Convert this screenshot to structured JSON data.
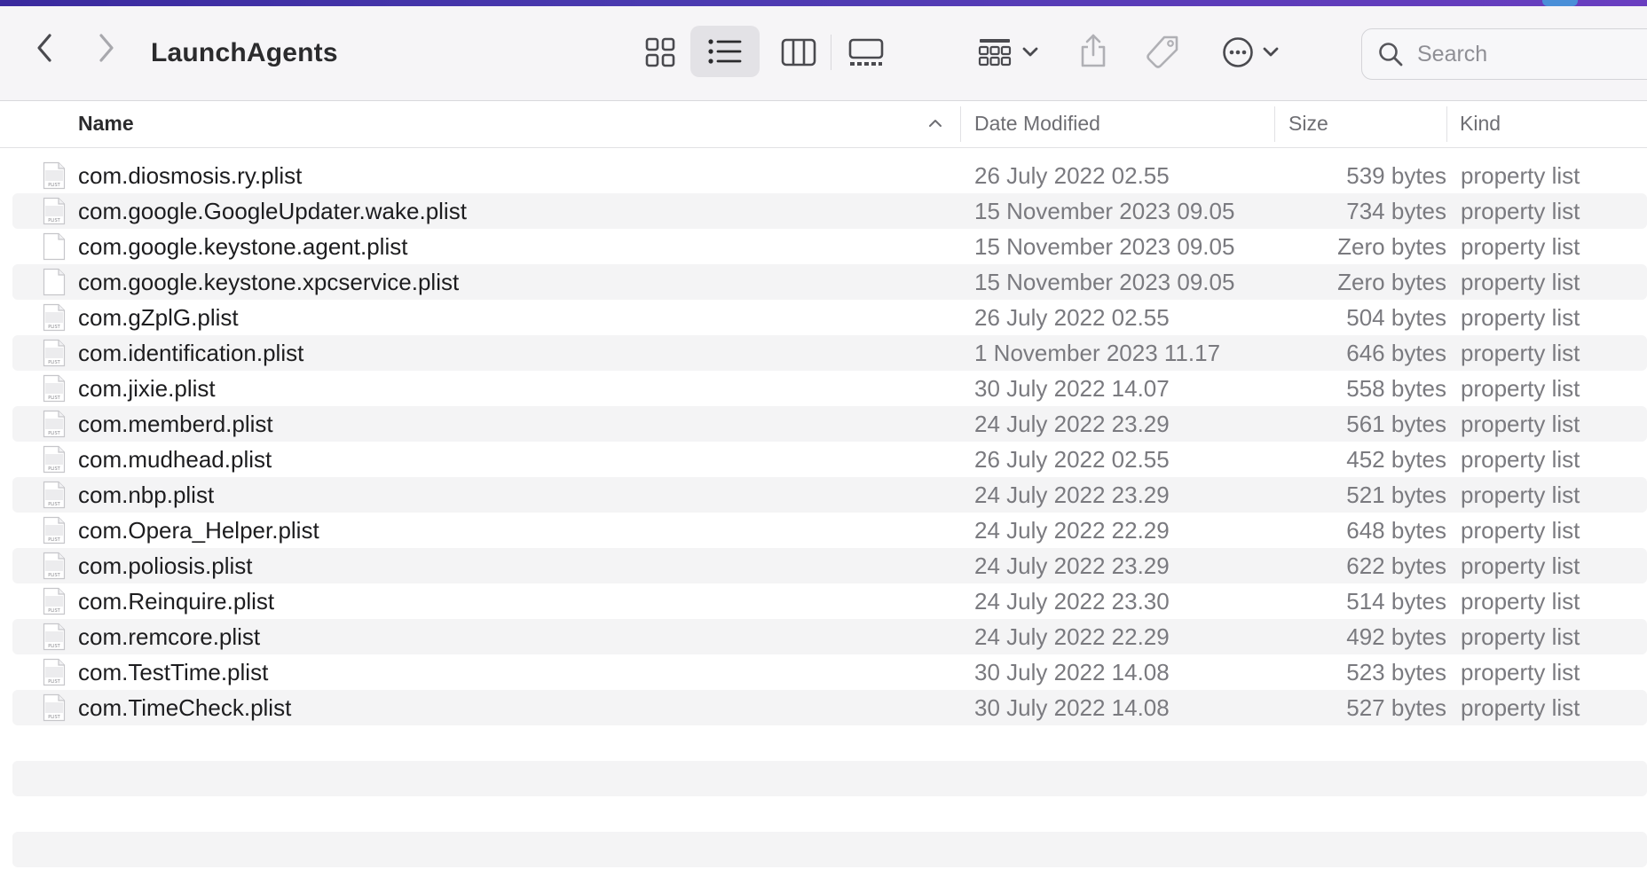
{
  "window": {
    "title": "LaunchAgents"
  },
  "toolbar": {
    "back_icon": "chevron-left-icon",
    "forward_icon": "chevron-right-icon",
    "views": [
      {
        "name": "icon-view",
        "icon": "grid-icon",
        "active": false
      },
      {
        "name": "list-view",
        "icon": "list-icon",
        "active": true
      },
      {
        "name": "column-view",
        "icon": "columns-icon",
        "active": false
      },
      {
        "name": "gallery-view",
        "icon": "gallery-icon",
        "active": false
      }
    ],
    "group_icon": "group-icon",
    "share_icon": "share-icon",
    "tag_icon": "tag-icon",
    "more_icon": "more-icon",
    "search": {
      "placeholder": "Search"
    }
  },
  "columns": {
    "name": "Name",
    "date": "Date Modified",
    "size": "Size",
    "kind": "Kind"
  },
  "files": [
    {
      "name": "com.diosmosis.ry.plist",
      "date": "26 July 2022 02.55",
      "size": "539 bytes",
      "kind": "property list",
      "icon": "plist"
    },
    {
      "name": "com.google.GoogleUpdater.wake.plist",
      "date": "15 November 2023 09.05",
      "size": "734 bytes",
      "kind": "property list",
      "icon": "plist"
    },
    {
      "name": "com.google.keystone.agent.plist",
      "date": "15 November 2023 09.05",
      "size": "Zero bytes",
      "kind": "property list",
      "icon": "blank"
    },
    {
      "name": "com.google.keystone.xpcservice.plist",
      "date": "15 November 2023 09.05",
      "size": "Zero bytes",
      "kind": "property list",
      "icon": "blank"
    },
    {
      "name": "com.gZplG.plist",
      "date": "26 July 2022 02.55",
      "size": "504 bytes",
      "kind": "property list",
      "icon": "plist"
    },
    {
      "name": "com.identification.plist",
      "date": "1 November 2023 11.17",
      "size": "646 bytes",
      "kind": "property list",
      "icon": "plist"
    },
    {
      "name": "com.jixie.plist",
      "date": "30 July 2022 14.07",
      "size": "558 bytes",
      "kind": "property list",
      "icon": "plist"
    },
    {
      "name": "com.memberd.plist",
      "date": "24 July 2022 23.29",
      "size": "561 bytes",
      "kind": "property list",
      "icon": "plist"
    },
    {
      "name": "com.mudhead.plist",
      "date": "26 July 2022 02.55",
      "size": "452 bytes",
      "kind": "property list",
      "icon": "plist"
    },
    {
      "name": "com.nbp.plist",
      "date": "24 July 2022 23.29",
      "size": "521 bytes",
      "kind": "property list",
      "icon": "plist"
    },
    {
      "name": "com.Opera_Helper.plist",
      "date": "24 July 2022 22.29",
      "size": "648 bytes",
      "kind": "property list",
      "icon": "plist"
    },
    {
      "name": "com.poliosis.plist",
      "date": "24 July 2022 23.29",
      "size": "622 bytes",
      "kind": "property list",
      "icon": "plist"
    },
    {
      "name": "com.Reinquire.plist",
      "date": "24 July 2022 23.30",
      "size": "514 bytes",
      "kind": "property list",
      "icon": "plist"
    },
    {
      "name": "com.remcore.plist",
      "date": "24 July 2022 22.29",
      "size": "492 bytes",
      "kind": "property list",
      "icon": "plist"
    },
    {
      "name": "com.TestTime.plist",
      "date": "30 July 2022 14.08",
      "size": "523 bytes",
      "kind": "property list",
      "icon": "plist"
    },
    {
      "name": "com.TimeCheck.plist",
      "date": "30 July 2022 14.08",
      "size": "527 bytes",
      "kind": "property list",
      "icon": "plist"
    }
  ],
  "file_icon_label": "PLIST"
}
